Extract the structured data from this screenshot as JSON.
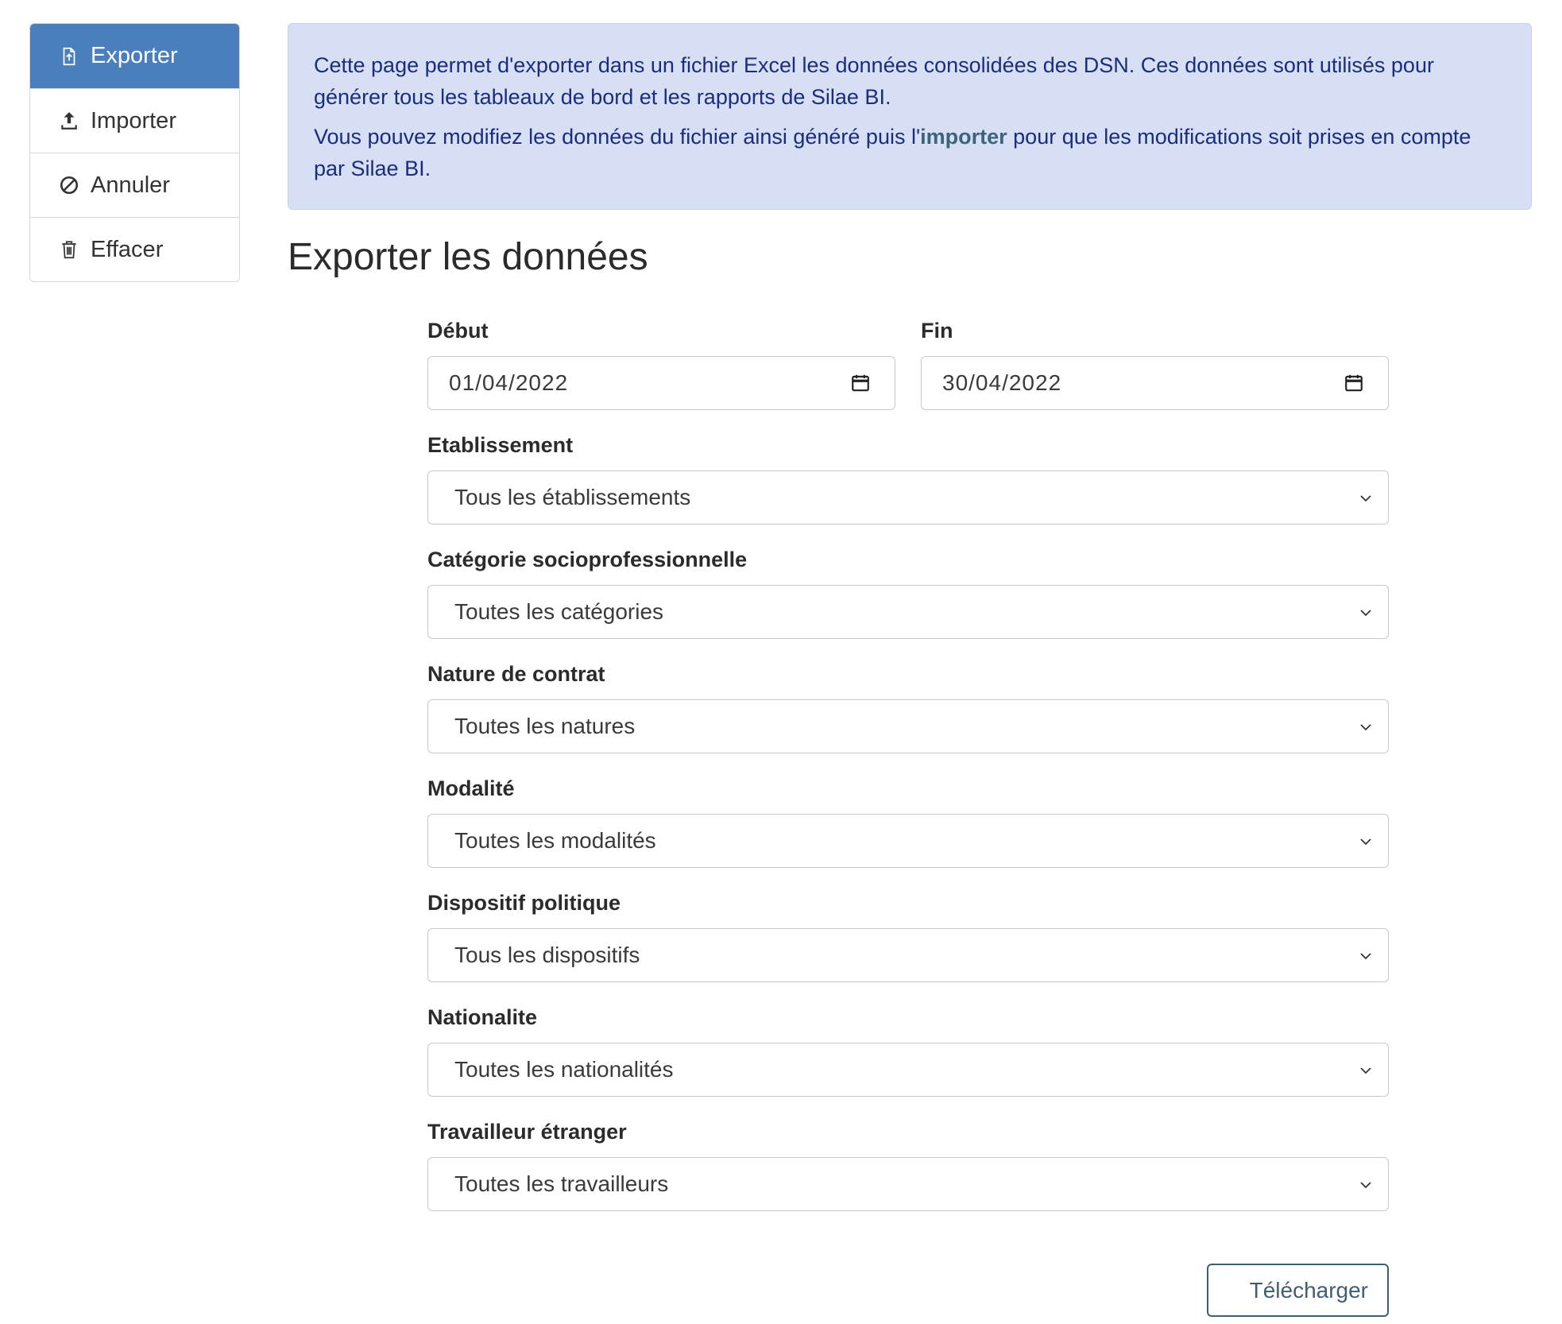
{
  "sidebar": {
    "items": [
      {
        "label": "Exporter",
        "icon": "file-export-icon",
        "active": true
      },
      {
        "label": "Importer",
        "icon": "upload-icon",
        "active": false
      },
      {
        "label": "Annuler",
        "icon": "ban-icon",
        "active": false
      },
      {
        "label": "Effacer",
        "icon": "trash-icon",
        "active": false
      }
    ]
  },
  "alert": {
    "line1": "Cette page permet d'exporter dans un fichier Excel les données consolidées des DSN. Ces données sont utilisés pour générer tous les tableaux de bord et les rapports de Silae BI.",
    "line2_before": "Vous pouvez modifiez les données du fichier ainsi généré puis l'",
    "line2_link": "importer",
    "line2_after": " pour que les modifications soit prises en compte par Silae BI."
  },
  "title": "Exporter les données",
  "form": {
    "debut": {
      "label": "Début",
      "value": "01/04/2022"
    },
    "fin": {
      "label": "Fin",
      "value": "30/04/2022"
    },
    "etablissement": {
      "label": "Etablissement",
      "value": "Tous les établissements"
    },
    "categorie": {
      "label": "Catégorie socioprofessionnelle",
      "value": "Toutes les catégories"
    },
    "nature": {
      "label": "Nature de contrat",
      "value": "Toutes les natures"
    },
    "modalite": {
      "label": "Modalité",
      "value": "Toutes les modalités"
    },
    "dispositif": {
      "label": "Dispositif politique",
      "value": "Tous les dispositifs"
    },
    "nationalite": {
      "label": "Nationalite",
      "value": "Toutes les nationalités"
    },
    "travailleur": {
      "label": "Travailleur étranger",
      "value": "Toutes les travailleurs"
    }
  },
  "download_label": "Télécharger",
  "colors": {
    "active": "#4a7ebd",
    "alert_bg": "#d6dff3",
    "alert_text": "#1b2d7c",
    "button": "#3f5f70"
  }
}
